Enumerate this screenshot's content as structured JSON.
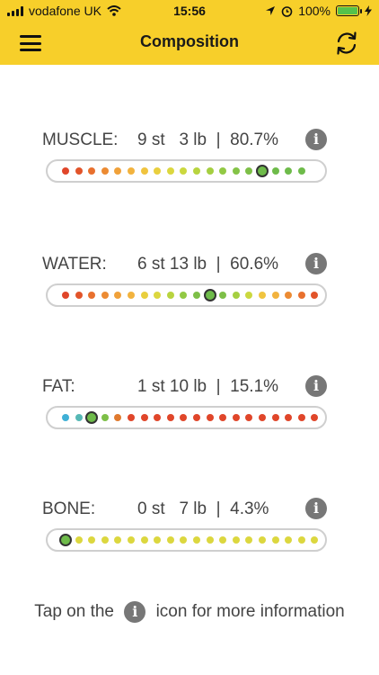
{
  "status_bar": {
    "carrier": "vodafone UK",
    "time": "15:56",
    "battery": "100%"
  },
  "nav": {
    "title": "Composition"
  },
  "metrics": [
    {
      "label": "MUSCLE:",
      "value": "9 st   3 lb  |  80.7%",
      "info_glyph": "i",
      "dots": [
        "#e0462a",
        "#e2542a",
        "#e8702e",
        "#ec8b33",
        "#f0a13a",
        "#f2b33e",
        "#f0c43f",
        "#e9cf3e",
        "#dcd73f",
        "#cbd83f",
        "#b8d43f",
        "#a5cf41",
        "#92c944",
        "#84c347",
        "#7dbf47",
        "#6ebb4a",
        "#6ebb4a",
        "#6ebb4a",
        "#6ebb4a"
      ],
      "marker_index": 15
    },
    {
      "label": "WATER:",
      "value": "6 st 13 lb  |  60.6%",
      "info_glyph": "i",
      "dots": [
        "#e0462a",
        "#e2542a",
        "#e8702e",
        "#ec8b33",
        "#f0a13a",
        "#f2b33e",
        "#e9cf3e",
        "#dcd73f",
        "#b8d43f",
        "#92c944",
        "#7dbf47",
        "#6ebb4a",
        "#7dbf47",
        "#a5cf41",
        "#cbd83f",
        "#f0c43f",
        "#f2b33e",
        "#ec8b33",
        "#e8702e",
        "#e2542a"
      ],
      "marker_index": 11
    },
    {
      "label": "FAT:",
      "value": "1 st 10 lb  |  15.1%",
      "info_glyph": "i",
      "dots": [
        "#3fb0d6",
        "#56b8b5",
        "#6ebb4a",
        "#7dbf47",
        "#e07a2e",
        "#e0462a",
        "#e0462a",
        "#e0462a",
        "#e0462a",
        "#e0462a",
        "#e0462a",
        "#e0462a",
        "#e0462a",
        "#e0462a",
        "#e0462a",
        "#e0462a",
        "#e0462a",
        "#e0462a",
        "#e0462a",
        "#e0462a"
      ],
      "marker_index": 2
    },
    {
      "label": "BONE:",
      "value": "0 st   7 lb  |  4.3%",
      "info_glyph": "i",
      "dots": [
        "#6ebb4a",
        "#dcd73f",
        "#dcd73f",
        "#dcd73f",
        "#dcd73f",
        "#dcd73f",
        "#dcd73f",
        "#dcd73f",
        "#dcd73f",
        "#dcd73f",
        "#dcd73f",
        "#dcd73f",
        "#dcd73f",
        "#dcd73f",
        "#dcd73f",
        "#dcd73f",
        "#dcd73f",
        "#dcd73f",
        "#dcd73f",
        "#dcd73f"
      ],
      "marker_index": 0
    }
  ],
  "footer": {
    "prefix": "Tap on the",
    "info_glyph": "i",
    "suffix": "icon for more information"
  },
  "colors": {
    "header_bg": "#f7cf2a",
    "marker_border": "#333333"
  }
}
